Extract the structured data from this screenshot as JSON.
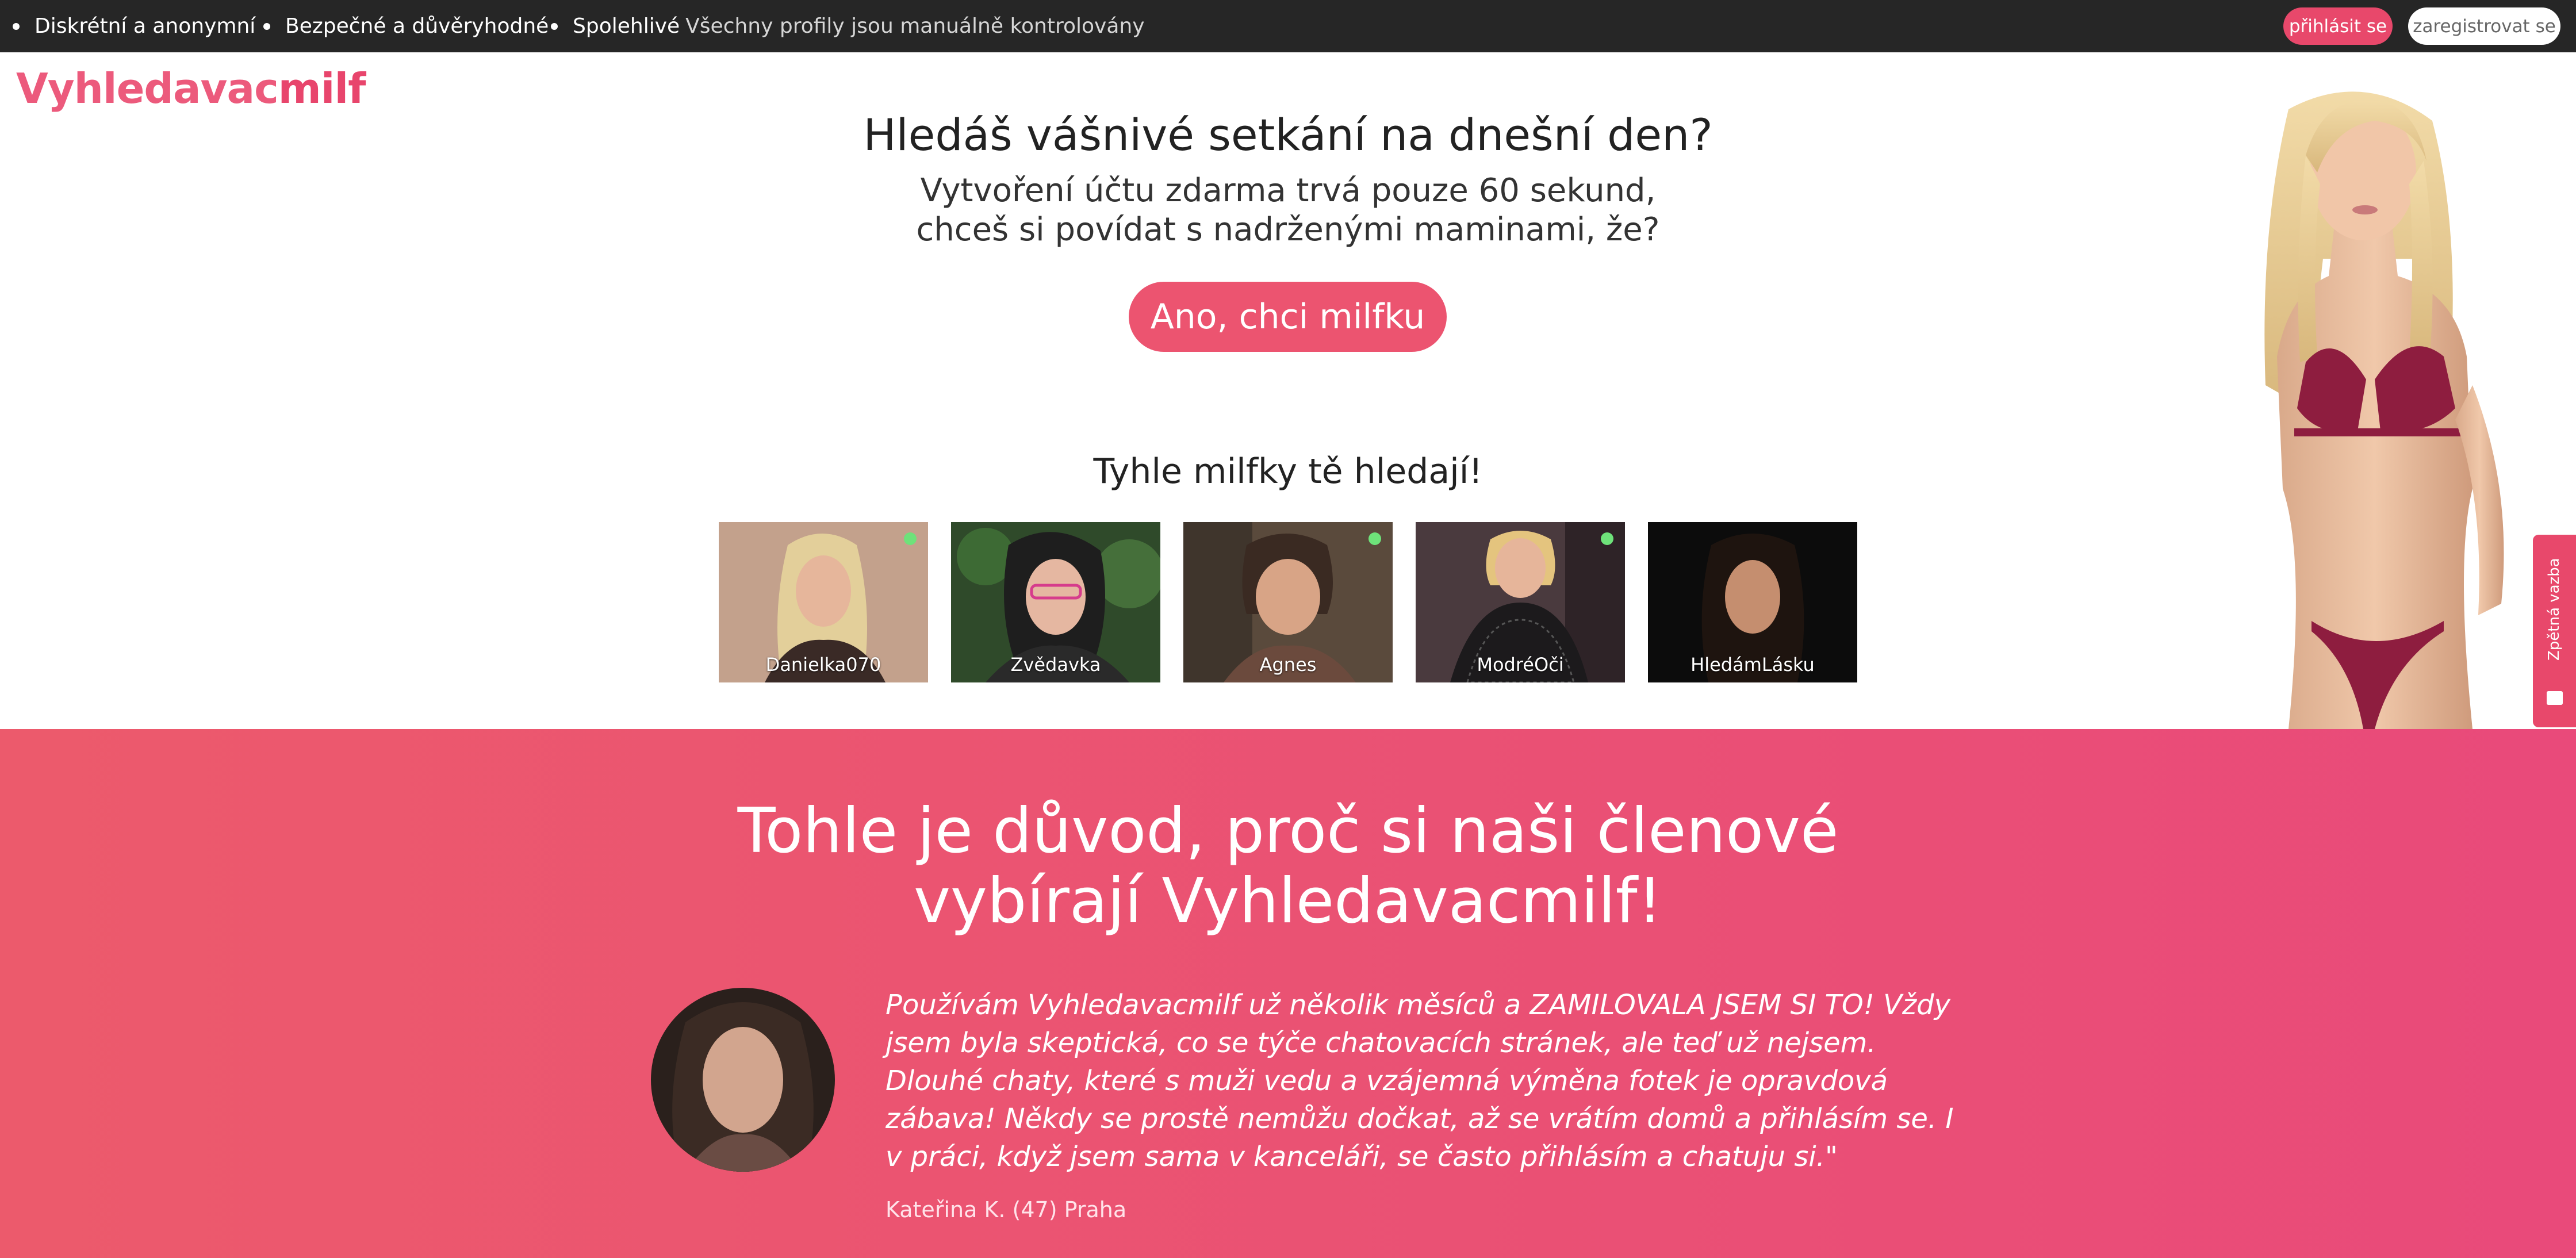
{
  "topbar": {
    "features": [
      {
        "strong": "Diskrétní a anonymní",
        "light": ""
      },
      {
        "strong": "Bezpečné a důvěryhodné",
        "light": ""
      },
      {
        "strong": "Spolehlivé",
        "light": "Všechny profily jsou manuálně kontrolovány"
      }
    ],
    "login_label": "přihlásit se",
    "register_label": "zaregistrovat se"
  },
  "logo": {
    "part1": "Vyhledavac",
    "part2": "milf"
  },
  "hero": {
    "title": "Hledáš vášnivé setkání na dnešní den?",
    "subtitle_line1": "Vytvoření účtu zdarma trvá pouze 60 sekund,",
    "subtitle_line2": "chceš si povídat s nadrženými maminami, že?",
    "cta_label": "Ano, chci milfku"
  },
  "profiles": {
    "title": "Tyhle milfky tě hledají!",
    "items": [
      {
        "name": "Danielka070",
        "online": true
      },
      {
        "name": "Zvědavka",
        "online": false
      },
      {
        "name": "Agnes",
        "online": true
      },
      {
        "name": "ModréOči",
        "online": true
      },
      {
        "name": "HledámLásku",
        "online": false
      }
    ]
  },
  "feedback": {
    "label": "Zpětná vazba"
  },
  "testimonial": {
    "section_title": "Tohle je důvod, proč si naši členové vybírají Vyhledavacmilf!",
    "quote": "Používám Vyhledavacmilf už několik měsíců a ZAMILOVALA JSEM SI TO! Vždy jsem byla skeptická, co se týče chatovacích stránek, ale teď už nejsem. Dlouhé chaty, které s muži vedu a vzájemná výměna fotek je opravdová zábava! Někdy se prostě nemůžu dočkat, až se vrátím domů a přihlásím se. I v práci, když jsem sama v kanceláři, se často přihlásím a chatuju si.\"",
    "author": "Kateřina K. (47) Praha"
  },
  "colors": {
    "accent": "#e8486b",
    "topbar": "#262626",
    "band_start": "#ec5a6c",
    "band_end": "#e94a7a"
  }
}
